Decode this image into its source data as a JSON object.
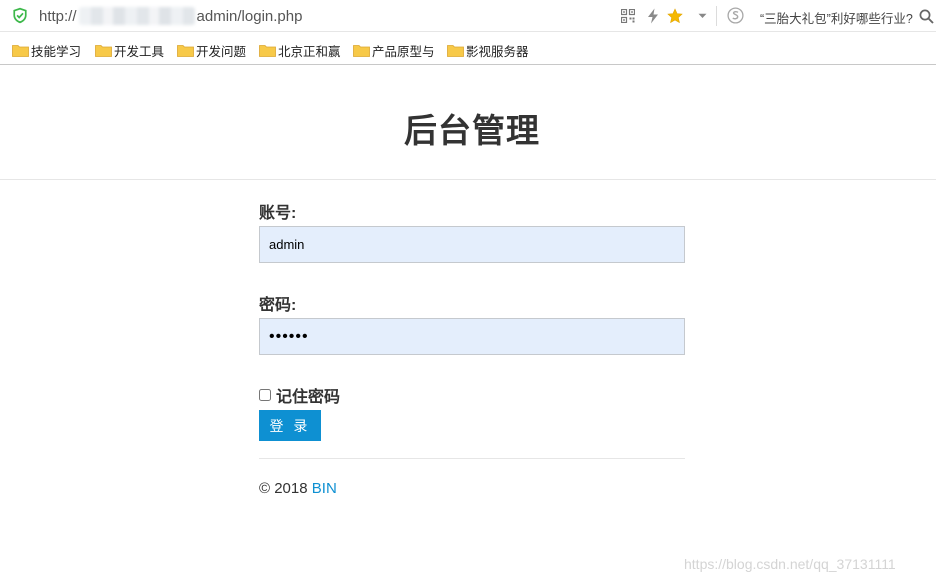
{
  "browser": {
    "url_prefix": "http://",
    "url_suffix": "admin/login.php",
    "hot_search_text": "“三胎大礼包”利好哪些行业?",
    "icons": {
      "security": "shield-check-icon",
      "qr": "qr-code-icon",
      "speed": "lightning-icon",
      "favorite": "star-icon",
      "menu": "chevron-down-icon",
      "search_engine": "sogou-s-icon",
      "search": "magnifier-icon"
    }
  },
  "bookmarks": [
    {
      "label": "技能学习"
    },
    {
      "label": "开发工具"
    },
    {
      "label": "开发问题"
    },
    {
      "label": "北京正和赢"
    },
    {
      "label": "产品原型与"
    },
    {
      "label": "影视服务器"
    }
  ],
  "page": {
    "title": "后台管理",
    "account_label": "账号:",
    "account_value": "admin",
    "password_label": "密码:",
    "password_value": "••••••",
    "remember_label": "记住密码",
    "remember_checked": false,
    "login_button": "登 录",
    "footer_copyright": "© 2018",
    "footer_link": "BIN"
  },
  "watermark": "https://blog.csdn.net/qq_37131111",
  "colors": {
    "accent": "#0e90d2",
    "input_bg": "#e4eefc",
    "bookmark_folder": "#f7c948",
    "star": "#f5b800",
    "shield": "#3db84a"
  }
}
